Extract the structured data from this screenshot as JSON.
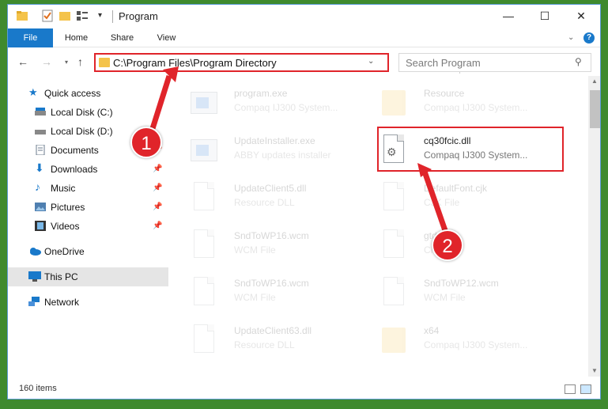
{
  "window": {
    "title": "Program",
    "minimize": "—",
    "maximize": "☐",
    "close": "✕"
  },
  "ribbon": {
    "tabs": [
      "File",
      "Home",
      "Share",
      "View"
    ]
  },
  "address": {
    "path": "C:\\Program Files\\Program Directory"
  },
  "search": {
    "placeholder": "Search Program"
  },
  "nav": {
    "items": [
      {
        "label": "Quick access",
        "icon": "star-icon"
      },
      {
        "label": "Local Disk (C:)",
        "icon": "drive-icon"
      },
      {
        "label": "Local Disk (D:)",
        "icon": "drive-icon"
      },
      {
        "label": "Documents",
        "icon": "documents-icon"
      },
      {
        "label": "Downloads",
        "icon": "download-icon"
      },
      {
        "label": "Music",
        "icon": "music-icon"
      },
      {
        "label": "Pictures",
        "icon": "pictures-icon"
      },
      {
        "label": "Videos",
        "icon": "videos-icon"
      },
      {
        "label": "OneDrive",
        "icon": "cloud-icon"
      },
      {
        "label": "This PC",
        "icon": "pc-icon"
      },
      {
        "label": "Network",
        "icon": "network-icon"
      }
    ]
  },
  "files": {
    "items": [
      {
        "name": "program.exe",
        "desc": "Compaq IJ300 System..."
      },
      {
        "name": "Resource",
        "desc": "Compaq IJ300 System..."
      },
      {
        "name": "UpdateInstaller.exe",
        "desc": "ABBY updates installer"
      },
      {
        "name": "cq30fcic.dll",
        "desc": "Compaq IJ300 System..."
      },
      {
        "name": "UpdateClient5.dll",
        "desc": "Resource DLL"
      },
      {
        "name": "DefaultFont.cjk",
        "desc": "CJK File"
      },
      {
        "name": "SndToWP16.wcm",
        "desc": "WCM File"
      },
      {
        "name": "gtd",
        "desc": "CKB"
      },
      {
        "name": "SndToWP16.wcm",
        "desc": "WCM File"
      },
      {
        "name": "SndToWP12.wcm",
        "desc": "WCM File"
      },
      {
        "name": "UpdateClient63.dll",
        "desc": "Resource DLL"
      },
      {
        "name": "x64",
        "desc": "Compaq IJ300 System..."
      }
    ]
  },
  "status": {
    "count": "160 items"
  },
  "callouts": {
    "one": "1",
    "two": "2"
  },
  "colors": {
    "accent": "#1979ca",
    "highlight": "#e0242a",
    "background": "#3f8a2e"
  }
}
